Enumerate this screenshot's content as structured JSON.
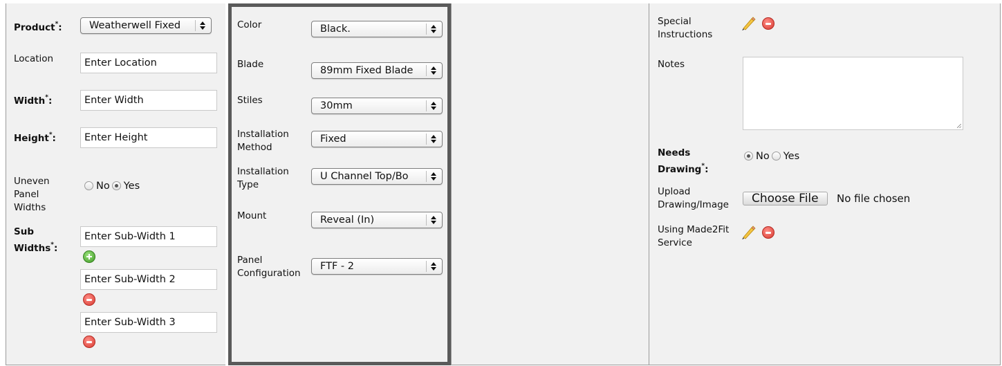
{
  "col1": {
    "product_label": "Product",
    "product_req": "*",
    "product_colon": ":",
    "product_value": "Weatherwell Fixed",
    "location_label": "Location",
    "location_placeholder": "Enter Location",
    "width_label": "Width",
    "width_req": "*",
    "width_colon": ":",
    "width_placeholder": "Enter Width",
    "height_label": "Height",
    "height_req": "*",
    "height_colon": ":",
    "height_placeholder": "Enter Height",
    "uneven_label_1": "Uneven",
    "uneven_label_2": "Panel",
    "uneven_label_3": "Widths",
    "uneven_no": "No",
    "uneven_yes": "Yes",
    "uneven_selected": "Yes",
    "subwidths_label_1": "Sub",
    "subwidths_label_2": "Widths",
    "subwidths_req": "*",
    "subwidths_colon": ":",
    "sub_width_1": "Enter Sub-Width 1",
    "sub_width_2": "Enter Sub-Width 2",
    "sub_width_3": "Enter Sub-Width 3"
  },
  "col2": {
    "color_label": "Color",
    "color_value": "Black.",
    "blade_label": "Blade",
    "blade_value": "89mm Fixed Blade",
    "stiles_label": "Stiles",
    "stiles_value": "30mm",
    "install_method_label_1": "Installation",
    "install_method_label_2": "Method",
    "install_method_value": "Fixed",
    "install_type_label_1": "Installation",
    "install_type_label_2": "Type",
    "install_type_value": "U Channel Top/Bo",
    "mount_label": "Mount",
    "mount_value": "Reveal (In)",
    "panel_config_label_1": "Panel",
    "panel_config_label_2": "Configuration",
    "panel_config_value": "FTF - 2"
  },
  "col4": {
    "special_label_1": "Special",
    "special_label_2": "Instructions",
    "notes_label": "Notes",
    "needs_drawing_label_1": "Needs",
    "needs_drawing_label_2": "Drawing",
    "needs_drawing_req": "*",
    "needs_drawing_colon": ":",
    "needs_no": "No",
    "needs_yes": "Yes",
    "needs_selected": "No",
    "upload_label_1": "Upload",
    "upload_label_2": "Drawing/Image",
    "choose_file": "Choose File",
    "file_status": "No file chosen",
    "made2fit_label_1": "Using Made2Fit",
    "made2fit_label_2": "Service"
  },
  "icons": {
    "edit": "pencil-icon",
    "remove": "remove-icon",
    "add": "add-icon"
  },
  "colors": {
    "panel_bg": "#f1f1f1",
    "highlight_border": "#5a5a5a"
  }
}
